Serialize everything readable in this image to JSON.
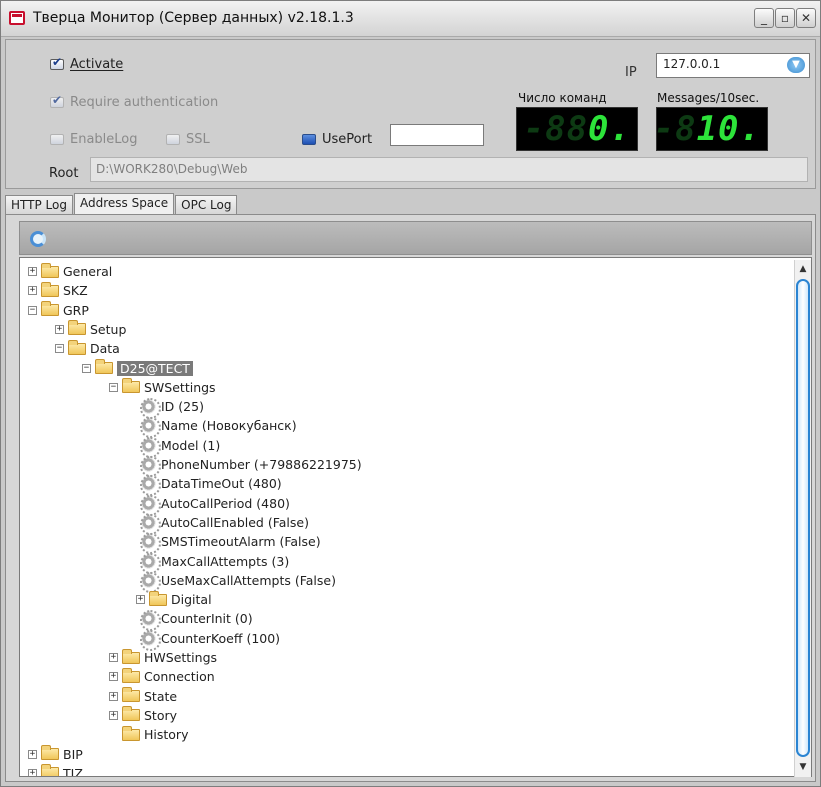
{
  "window": {
    "title": "Тверца Монитор (Сервер данных) v2.18.1.3",
    "controls": [
      "_",
      "▫",
      "✕"
    ]
  },
  "settings": {
    "activate": {
      "label": "Activate",
      "checked": true
    },
    "require_auth": {
      "label": "Require authentication",
      "checked": true
    },
    "enable_log": {
      "label": "EnableLog",
      "checked": false
    },
    "ssl": {
      "label": "SSL",
      "checked": false
    },
    "use_port": {
      "label": "UsePort",
      "checked": false,
      "value": ""
    },
    "ip_label": "IP",
    "ip_value": "127.0.0.1",
    "root_label": "Root",
    "root_value": "D:\\WORK280\\Debug\\Web"
  },
  "counters": {
    "commands_label": "Число команд",
    "commands_dim": "-88",
    "commands_lit": "0.",
    "messages_label": "Messages/10sec.",
    "messages_dim": "-8",
    "messages_lit": "10."
  },
  "tabs": [
    {
      "label": "HTTP Log",
      "active": false
    },
    {
      "label": "Address Space",
      "active": true
    },
    {
      "label": "OPC Log",
      "active": false
    }
  ],
  "tree": [
    {
      "label": "General",
      "type": "folder",
      "expander": "+",
      "level": 0
    },
    {
      "label": "SKZ",
      "type": "folder",
      "expander": "+",
      "level": 0
    },
    {
      "label": "GRP",
      "type": "folder",
      "expander": "-",
      "level": 0
    },
    {
      "label": "Setup",
      "type": "folder",
      "expander": "+",
      "level": 1
    },
    {
      "label": "Data",
      "type": "folder",
      "expander": "-",
      "level": 1
    },
    {
      "label": "D25@TECT",
      "type": "folder",
      "expander": "-",
      "level": 2,
      "selected": true
    },
    {
      "label": "SWSettings",
      "type": "folder",
      "expander": "-",
      "level": 3
    },
    {
      "label": "ID (25)",
      "type": "item",
      "level": 4
    },
    {
      "label": "Name (Новокубанск)",
      "type": "item",
      "level": 4
    },
    {
      "label": "Model (1)",
      "type": "item",
      "level": 4
    },
    {
      "label": "PhoneNumber (+79886221975)",
      "type": "item",
      "level": 4
    },
    {
      "label": "DataTimeOut (480)",
      "type": "item",
      "level": 4
    },
    {
      "label": "AutoCallPeriod (480)",
      "type": "item",
      "level": 4
    },
    {
      "label": "AutoCallEnabled (False)",
      "type": "item",
      "level": 4
    },
    {
      "label": "SMSTimeoutAlarm (False)",
      "type": "item",
      "level": 4
    },
    {
      "label": "MaxCallAttempts (3)",
      "type": "item",
      "level": 4
    },
    {
      "label": "UseMaxCallAttempts (False)",
      "type": "item",
      "level": 4
    },
    {
      "label": "Digital",
      "type": "folder",
      "expander": "+",
      "level": 4
    },
    {
      "label": "CounterInit (0)",
      "type": "item",
      "level": 4
    },
    {
      "label": "CounterKoeff (100)",
      "type": "item",
      "level": 4
    },
    {
      "label": "HWSettings",
      "type": "folder",
      "expander": "+",
      "level": 3
    },
    {
      "label": "Connection",
      "type": "folder",
      "expander": "+",
      "level": 3
    },
    {
      "label": "State",
      "type": "folder",
      "expander": "+",
      "level": 3
    },
    {
      "label": "Story",
      "type": "folder",
      "expander": "+",
      "level": 3
    },
    {
      "label": "History",
      "type": "folder",
      "expander": "",
      "level": 3
    },
    {
      "label": "BIP",
      "type": "folder",
      "expander": "+",
      "level": 0
    },
    {
      "label": "TIZ",
      "type": "folder",
      "expander": "+",
      "level": 0
    }
  ],
  "scrollbar": {
    "up": "▲",
    "down": "▼"
  }
}
